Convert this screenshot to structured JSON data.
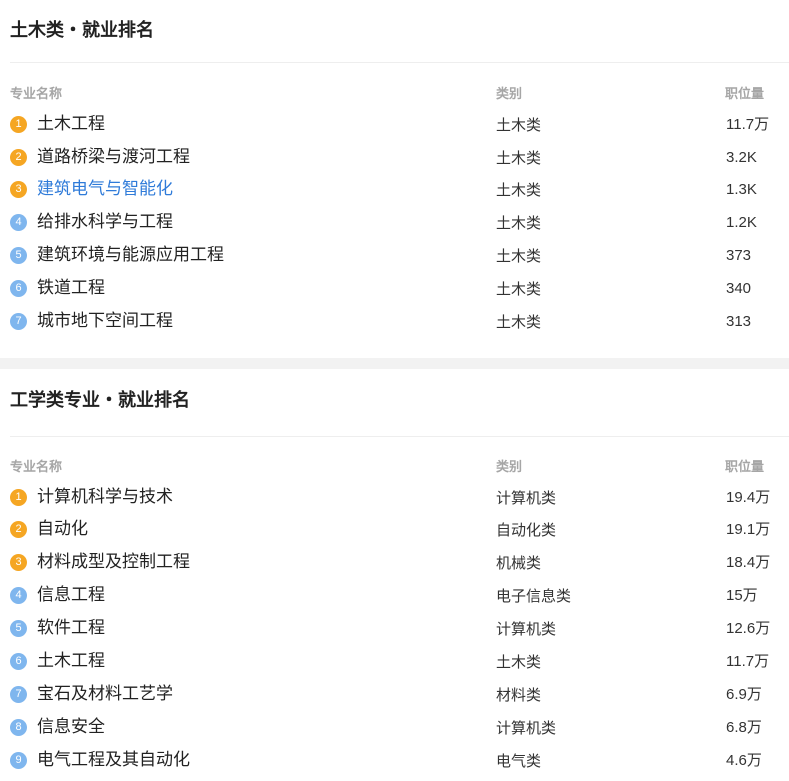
{
  "section1": {
    "title": "土木类・就业排名",
    "headers": {
      "name": "专业名称",
      "category": "类别",
      "count": "职位量"
    },
    "rows": [
      {
        "rank": "1",
        "name": "土木工程",
        "category": "土木类",
        "count": "11.7万"
      },
      {
        "rank": "2",
        "name": "道路桥梁与渡河工程",
        "category": "土木类",
        "count": "3.2K"
      },
      {
        "rank": "3",
        "name": "建筑电气与智能化",
        "category": "土木类",
        "count": "1.3K"
      },
      {
        "rank": "4",
        "name": "给排水科学与工程",
        "category": "土木类",
        "count": "1.2K"
      },
      {
        "rank": "5",
        "name": "建筑环境与能源应用工程",
        "category": "土木类",
        "count": "373"
      },
      {
        "rank": "6",
        "name": "铁道工程",
        "category": "土木类",
        "count": "340"
      },
      {
        "rank": "7",
        "name": "城市地下空间工程",
        "category": "土木类",
        "count": "313"
      }
    ]
  },
  "section2": {
    "title": "工学类专业・就业排名",
    "headers": {
      "name": "专业名称",
      "category": "类别",
      "count": "职位量"
    },
    "rows": [
      {
        "rank": "1",
        "name": "计算机科学与技术",
        "category": "计算机类",
        "count": "19.4万"
      },
      {
        "rank": "2",
        "name": "自动化",
        "category": "自动化类",
        "count": "19.1万"
      },
      {
        "rank": "3",
        "name": "材料成型及控制工程",
        "category": "机械类",
        "count": "18.4万"
      },
      {
        "rank": "4",
        "name": "信息工程",
        "category": "电子信息类",
        "count": "15万"
      },
      {
        "rank": "5",
        "name": "软件工程",
        "category": "计算机类",
        "count": "12.6万"
      },
      {
        "rank": "6",
        "name": "土木工程",
        "category": "土木类",
        "count": "11.7万"
      },
      {
        "rank": "7",
        "name": "宝石及材料工艺学",
        "category": "材料类",
        "count": "6.9万"
      },
      {
        "rank": "8",
        "name": "信息安全",
        "category": "计算机类",
        "count": "6.8万"
      },
      {
        "rank": "9",
        "name": "电气工程及其自动化",
        "category": "电气类",
        "count": "4.6万"
      }
    ]
  },
  "colors": {
    "top_badge": "#f5a623",
    "rest_badge": "#7fb6ee",
    "link": "#2f7bd9"
  }
}
